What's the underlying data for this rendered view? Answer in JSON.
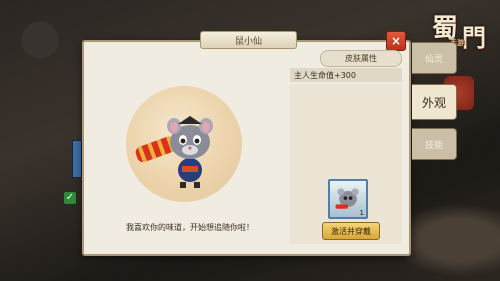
{
  "window": {
    "title": "仙灵",
    "help_label": "?"
  },
  "logo": {
    "text_main_1": "蜀",
    "text_main_2": "門",
    "text_small": "手游"
  },
  "side_tabs": [
    {
      "label": "仙灵",
      "state": "normal"
    },
    {
      "label": "外观",
      "state": "active"
    },
    {
      "label": "技能",
      "state": "normal"
    }
  ],
  "modal": {
    "pet_name": "鼠小仙",
    "close_label": "×",
    "caption": "我喜欢你的味道，开始想追随你啦！",
    "attributes": {
      "header": "皮肤属性",
      "rows": [
        "主人生命值+300"
      ]
    },
    "item": {
      "quantity": "1",
      "icon": "mouse-skin-icon"
    },
    "activate_label": "激活并穿戴"
  },
  "colors": {
    "accent_red": "#c8402a",
    "gold_button": "#e6bb52",
    "frame": "#a89878"
  }
}
